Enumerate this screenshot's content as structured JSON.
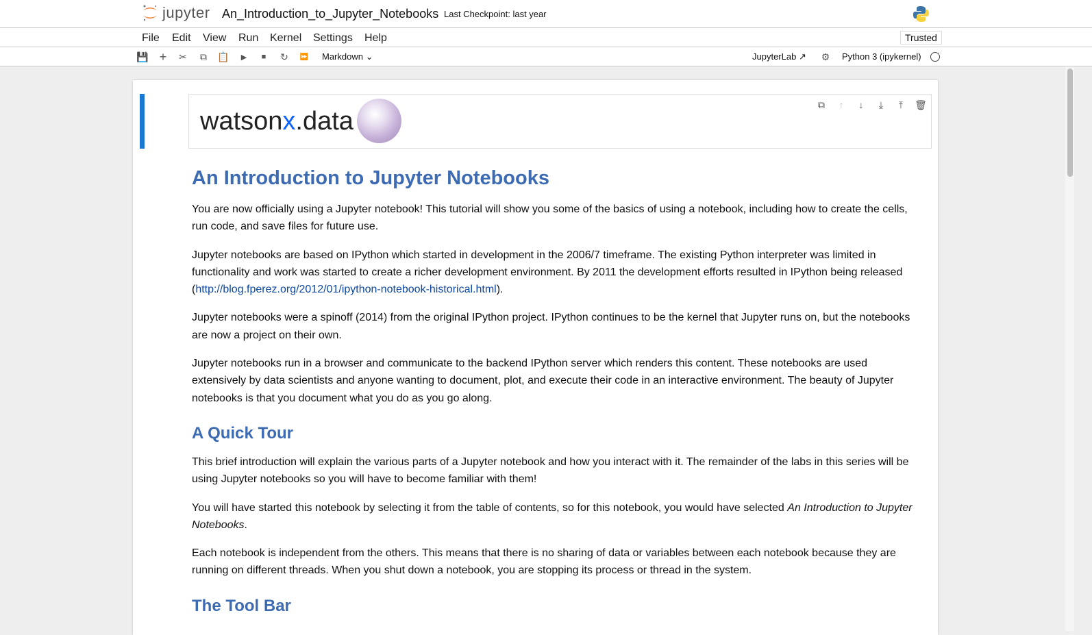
{
  "header": {
    "logo_text": "jupyter",
    "notebook_title": "An_Introduction_to_Jupyter_Notebooks",
    "checkpoint": "Last Checkpoint: last year",
    "kernel_logo": "python-logo-icon"
  },
  "menu": {
    "items": [
      "File",
      "Edit",
      "View",
      "Run",
      "Kernel",
      "Settings",
      "Help"
    ],
    "trusted": "Trusted"
  },
  "toolbar": {
    "icons": [
      "save-icon",
      "add-icon",
      "cut-icon",
      "copy-icon",
      "paste-icon",
      "run-icon",
      "stop-icon",
      "restart-icon",
      "fast-forward-icon"
    ],
    "cell_type": "Markdown",
    "jupyterlab": "JupyterLab",
    "kernel": "Python 3 (ipykernel)"
  },
  "cell": {
    "logo_prefix": "watson",
    "logo_x": "x",
    "logo_suffix": ".data",
    "actions": [
      "duplicate-icon",
      "move-up-icon",
      "move-down-icon",
      "insert-above-icon",
      "insert-below-icon",
      "delete-icon"
    ]
  },
  "content": {
    "h1": "An Introduction to Jupyter Notebooks",
    "p1": "You are now officially using a Jupyter notebook! This tutorial will show you some of the basics of using a notebook, including how to create the cells, run code, and save files for future use.",
    "p2_a": "Jupyter notebooks are based on IPython which started in development in the 2006/7 timeframe. The existing Python interpreter was limited in functionality and work was started to create a richer development environment. By 2011 the development efforts resulted in IPython being released (",
    "p2_link": "http://blog.fperez.org/2012/01/ipython-notebook-historical.html",
    "p2_b": ").",
    "p3": "Jupyter notebooks were a spinoff (2014) from the original IPython project. IPython continues to be the kernel that Jupyter runs on, but the notebooks are now a project on their own.",
    "p4": "Jupyter notebooks run in a browser and communicate to the backend IPython server which renders this content. These notebooks are used extensively by data scientists and anyone wanting to document, plot, and execute their code in an interactive environment. The beauty of Jupyter notebooks is that you document what you do as you go along.",
    "h2a": "A Quick Tour",
    "p5": "This brief introduction will explain the various parts of a Jupyter notebook and how you interact with it. The remainder of the labs in this series will be using Jupyter notebooks so you will have to become familiar with them!",
    "p6_a": "You will have started this notebook by selecting it from the table of contents, so for this notebook, you would have selected ",
    "p6_em": "An Introduction to Jupyter Notebooks",
    "p6_b": ".",
    "p7": "Each notebook is independent from the others. This means that there is no sharing of data or variables between each notebook because they are running on different threads. When you shut down a notebook, you are stopping its process or thread in the system.",
    "h2b": "The Tool Bar"
  }
}
